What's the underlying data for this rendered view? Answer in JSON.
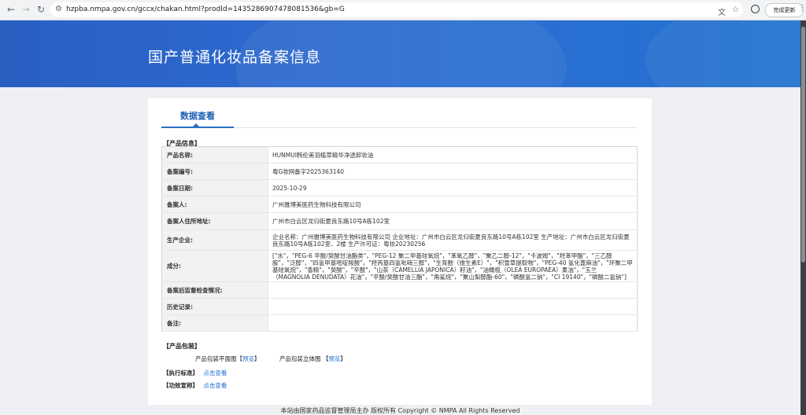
{
  "browser": {
    "url": "hzpba.nmpa.gov.cn/gccx/chakan.html?prodId=1435286907478081536&gb=G",
    "update_label": "完成更新"
  },
  "banner": {
    "title": "国产普通化妆品备案信息"
  },
  "tab": {
    "label": "数据查看"
  },
  "product_info": {
    "section_title": "【产品信息】",
    "rows": [
      {
        "label": "产品名称:",
        "value": "HUNMUI韩伦美羽植萃精华净透卸妆油"
      },
      {
        "label": "备案编号:",
        "value": "粤G妆网备字2025363140"
      },
      {
        "label": "备案日期:",
        "value": "2025-10-29"
      },
      {
        "label": "备案人:",
        "value": "广州雅博美医药生物科技有限公司"
      },
      {
        "label": "备案人住所地址:",
        "value": "广州市白云区龙归街夏良东路10号A栋102室"
      },
      {
        "label": "生产企业:",
        "value": "企业名称：广州雅博美医药生物科技有限公司 企业地址：广州市白云区龙归街夏良东路10号A栋102室 生产地址：广州市白云区龙归街夏良东路10号A栋102室、2楼 生产许可证：粤妆20230256"
      },
      {
        "label": "成分:",
        "value": "[\"水\"，\"PEG-6 辛酸/癸酸甘油酯类\"，\"PEG-12 聚二甲基硅氧烷\"，\"苯氧乙醇\"，\"聚乙二醇-12\"，\"卡波姆\"，\"羟苯甲酯\"，\"三乙醇胺\"，\"泛醇\"，\"四氢甲基嘧啶羧酸\"，\"羟丙基四氢吡喃三醇\"，\"生育酚（维生素E）\"，\"积雪草提取物\"，\"PEG-40 氢化蓖麻油\"，\"环聚二甲基硅氧烷\"，\"香精\"，\"癸酸\"，\"辛酸\"，\"山茶（CAMELLIA JAPONICA）籽油\"，\"油橄榄（OLEA EUROPAEA）果油\"，\"玉兰（MAGNOLIA DENUDATA）花油\"，\"辛酸/癸酸甘油三酯\"，\"角鲨烷\"，\"聚山梨醇酯-60\"，\"磷酸氢二钠\"，\"CI 19140\"，\"磷酸二氢钠\"]"
      },
      {
        "label": "备案后监督检查情况:",
        "value": ""
      },
      {
        "label": "历史记录:",
        "value": ""
      },
      {
        "label": "备注:",
        "value": ""
      }
    ]
  },
  "packaging": {
    "section_title": "【产品包装】",
    "flat_label": "产品包装平面图【",
    "flat_link": "预览",
    "flat_close": "】",
    "solid_label": "产品包装立体图 【",
    "solid_link": "预览",
    "solid_close": "】"
  },
  "standard": {
    "label": "【执行标准】",
    "link": "点击查看"
  },
  "efficacy": {
    "label": "【功效宣称】",
    "link": "点击查看"
  },
  "footer": {
    "text": "本站由国家药品监督管理局主办 版权所有 Copyright © NMPA All Rights Reserved"
  }
}
